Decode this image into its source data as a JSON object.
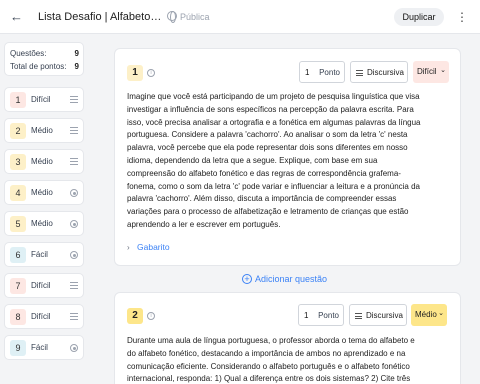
{
  "header": {
    "back_icon": "arrow-left-icon",
    "title": "Lista Desafio | Alfabeto e Acentuação",
    "visibility": "Pública",
    "duplicate_label": "Duplicar",
    "more_icon": "kebab-vertical-icon"
  },
  "summary": {
    "questions_label": "Questões:",
    "questions_value": "9",
    "points_label": "Total de pontos:",
    "points_value": "9"
  },
  "sidebar": {
    "items": [
      {
        "num": "1",
        "label": "Difícil",
        "icon": "lines-icon"
      },
      {
        "num": "2",
        "label": "Médio",
        "icon": "lines-icon"
      },
      {
        "num": "3",
        "label": "Médio",
        "icon": "lines-icon"
      },
      {
        "num": "4",
        "label": "Médio",
        "icon": "radio-icon"
      },
      {
        "num": "5",
        "label": "Médio",
        "icon": "radio-icon"
      },
      {
        "num": "6",
        "label": "Fácil",
        "icon": "radio-icon"
      },
      {
        "num": "7",
        "label": "Difícil",
        "icon": "lines-icon"
      },
      {
        "num": "8",
        "label": "Difícil",
        "icon": "lines-icon"
      },
      {
        "num": "9",
        "label": "Fácil",
        "icon": "radio-icon"
      }
    ]
  },
  "colors": {
    "dificil_bg": "#fde7e3",
    "medio_bg": "#fdf0c8",
    "facil_bg": "#dff0f5",
    "accent": "#3b82f6"
  },
  "questions": [
    {
      "num": "1",
      "points": "1",
      "points_unit": "Ponto",
      "type": "Discursiva",
      "difficulty": "Difícil",
      "text": "Imagine que você está participando de um projeto de pesquisa linguística que visa investigar a influência de sons específicos na percepção da palavra escrita. Para isso, você precisa analisar a ortografia e a fonética em algumas palavras da língua portuguesa. Considere a palavra 'cachorro'. Ao analisar o som da letra 'c' nesta palavra, você percebe que ela pode representar dois sons diferentes em nosso idioma, dependendo da letra que a segue. Explique, com base em sua compreensão do alfabeto fonético e das regras de correspondência grafema-fonema, como o som da letra 'c' pode variar e influenciar a leitura e a pronúncia da palavra 'cachorro'. Além disso, discuta a importância de compreender essas variações para o processo de alfabetização e letramento de crianças que estão aprendendo a ler e escrever em português.",
      "gabarito": "Gabarito"
    },
    {
      "num": "2",
      "points": "1",
      "points_unit": "Ponto",
      "type": "Discursiva",
      "difficulty": "Médio",
      "text": "Durante uma aula de língua portuguesa, o professor aborda o tema do alfabeto e do alfabeto fonético, destacando a importância de ambos no aprendizado e na comunicação eficiente. Considerando o alfabeto português e o alfabeto fonético internacional, responda: 1) Qual a diferença entre os dois sistemas? 2) Cite três"
    }
  ],
  "add_question_label": "Adicionar questão"
}
